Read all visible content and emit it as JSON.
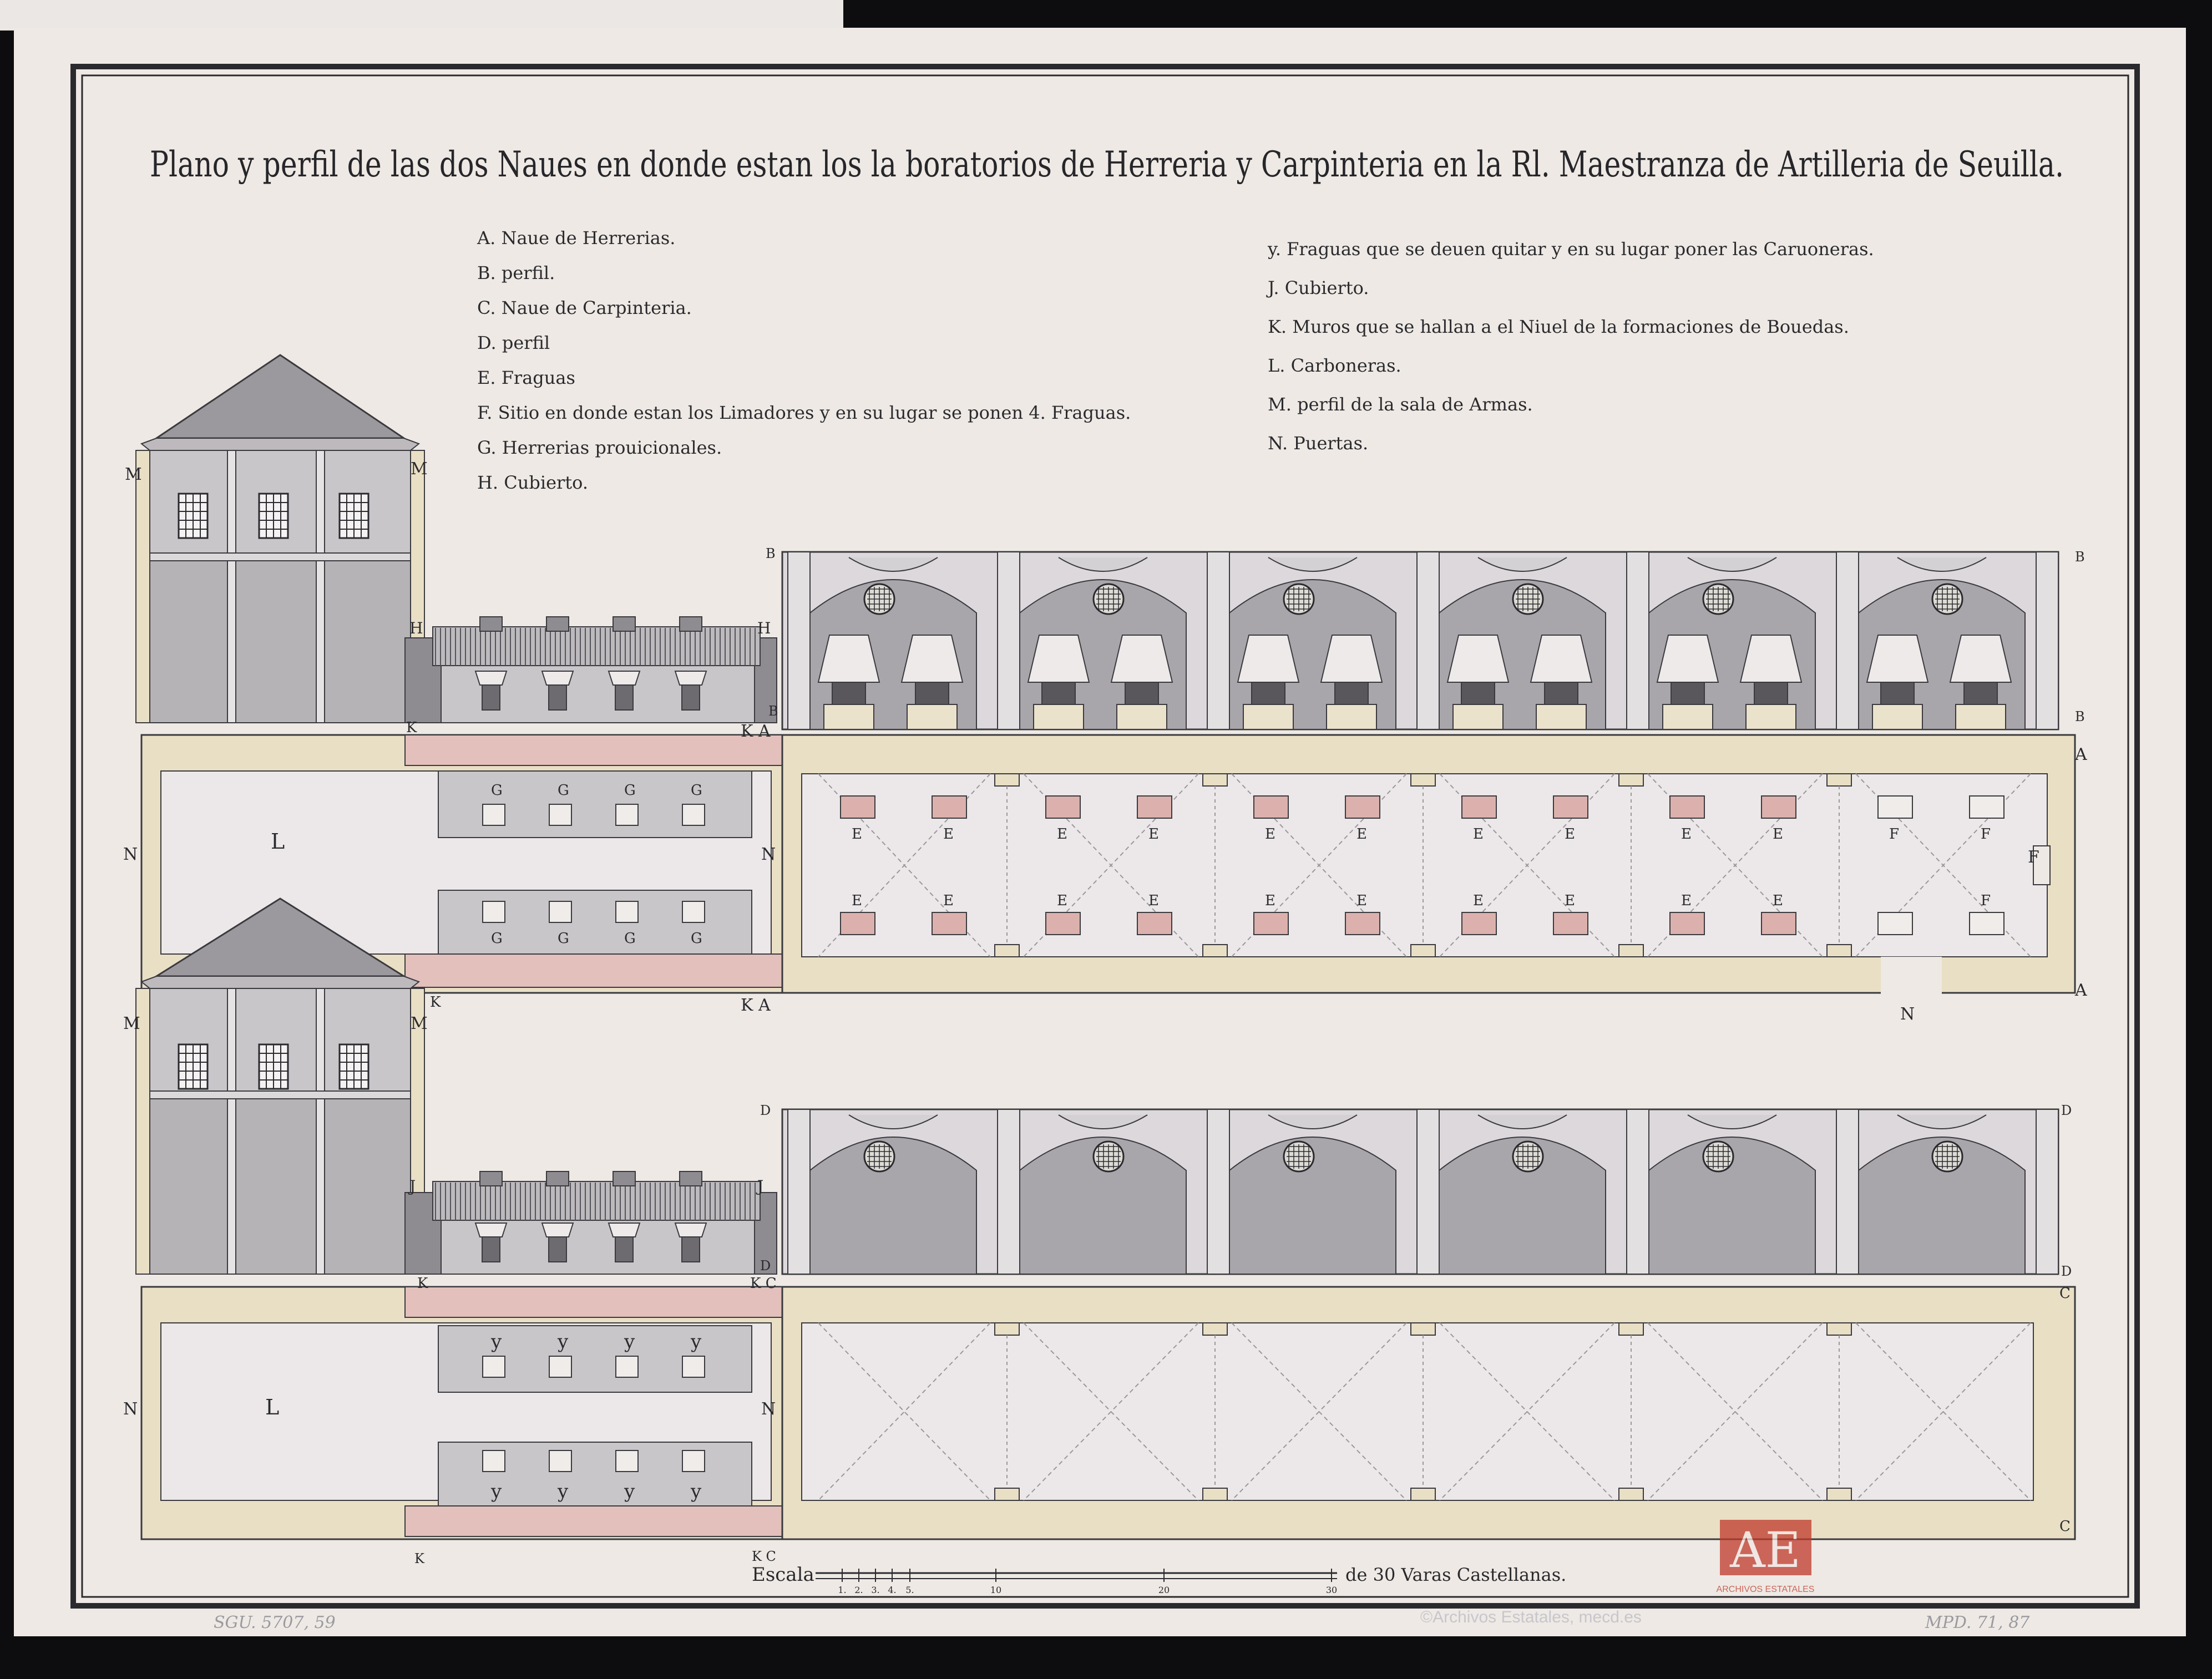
{
  "document": {
    "title": "Plano y perfil de las dos Naues en donde estan los la boratorios de Herreria y Carpinteria en la Rl. Maestranza de Artilleria de Seuilla."
  },
  "legend_left": [
    "A. Naue de Herrerias.",
    "B. perfil.",
    "C. Naue de Carpinteria.",
    "D. perfil",
    "E. Fraguas",
    "F. Sitio en donde estan los Limadores y en su lugar se ponen 4. Fraguas.",
    "G. Herrerias prouicionales.",
    "H. Cubierto."
  ],
  "legend_right": [
    "y. Fraguas que se deuen quitar y en su lugar poner las Caruoneras.",
    "J. Cubierto.",
    "K. Muros que se hallan a el Niuel de la formaciones de Bouedas.",
    "L. Carboneras.",
    "M. perfil de la sala de Armas.",
    "N. Puertas."
  ],
  "letters": {
    "a": "A",
    "b": "B",
    "c": "C",
    "d": "D",
    "e": "E",
    "f": "F",
    "g": "G",
    "h": "H",
    "j": "J",
    "k": "K",
    "l": "L",
    "m": "M",
    "n": "N",
    "y": "y",
    "ka": "K A",
    "kc": "K C"
  },
  "scale": {
    "prefix": "Escala",
    "suffix": "de 30 Varas Castellanas.",
    "ticks": [
      "1.",
      "2.",
      "3.",
      "4.",
      "5.",
      "10",
      "20",
      "30"
    ]
  },
  "footer": {
    "left_ref": "SGU. 5707, 59",
    "right_ref": "MPD. 71, 87",
    "copyright": "©Archivos Estatales, mecd.es",
    "stamp_letters": "AE",
    "stamp_text": "ARCHIVOS ESTATALES"
  },
  "colors": {
    "paper": "#eee9e4",
    "ink": "#2a2a2e",
    "wall_yellow": "#e9dfc5",
    "wall_pink": "#e3c0bc",
    "forge_pink": "#dcb1ad",
    "gray_dark": "#a9a6ab",
    "gray_mid": "#c6c3c7",
    "gray_light": "#dedbdd",
    "stamp": "#c0392b"
  }
}
